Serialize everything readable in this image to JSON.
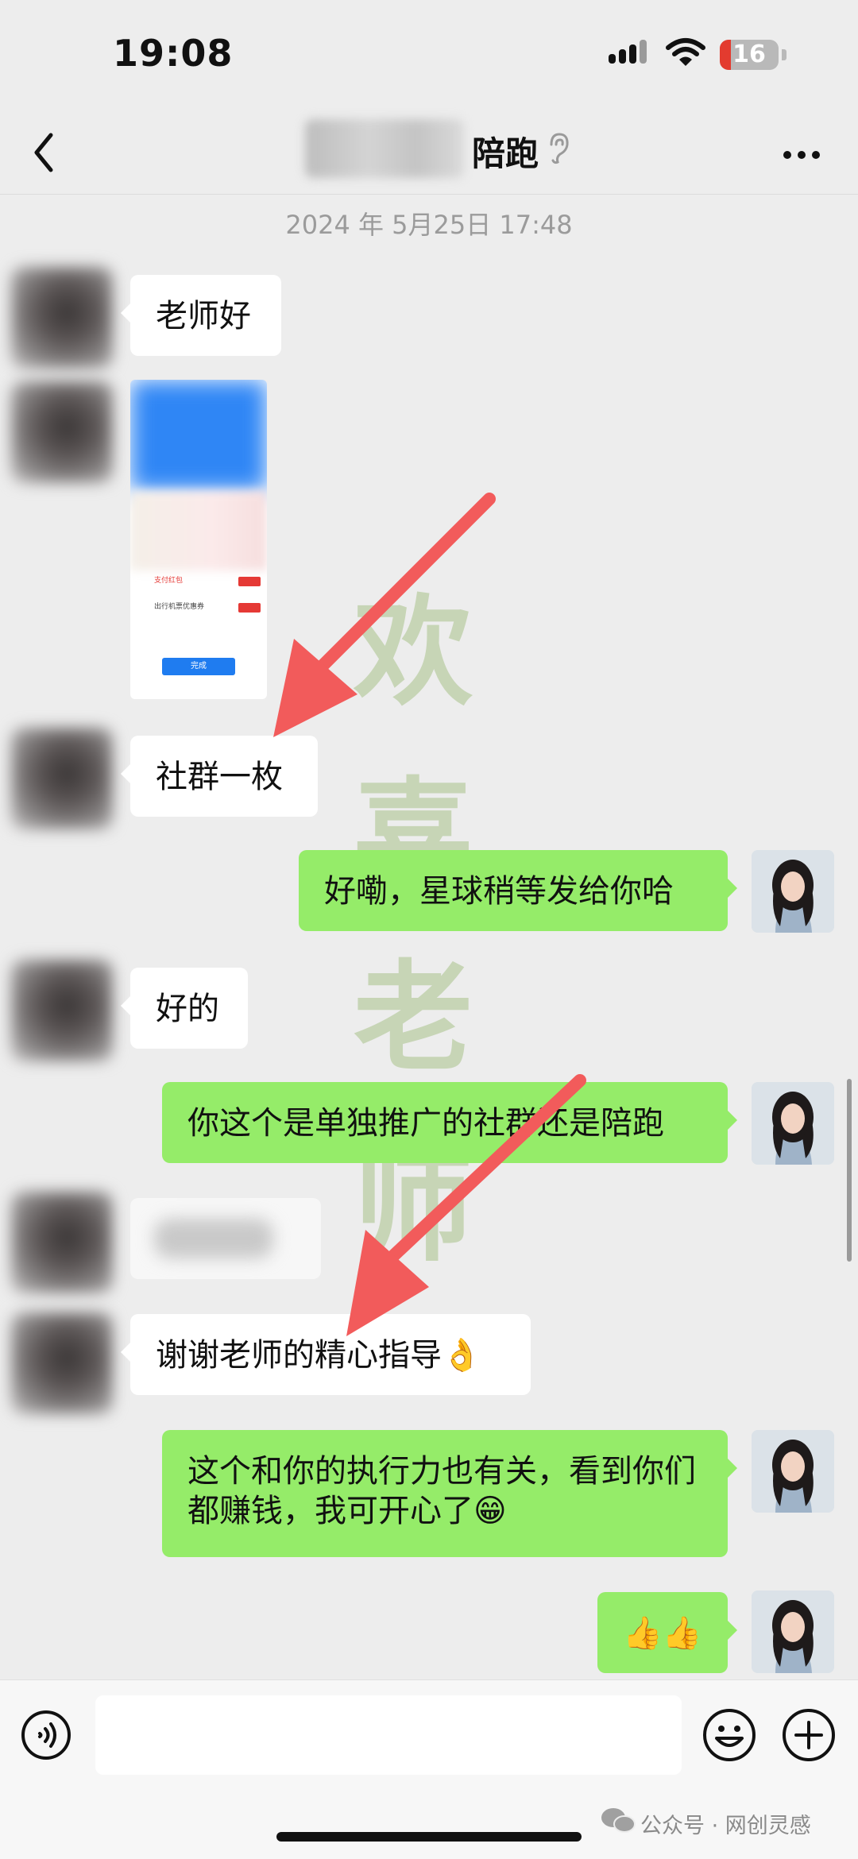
{
  "status_bar": {
    "time": "19:08",
    "battery": "16"
  },
  "nav": {
    "title": "陪跑"
  },
  "timestamp": "2024 年 5月25日 17:48",
  "messages": [
    {
      "side": "left",
      "text": "老师好"
    },
    {
      "side": "left",
      "type": "image",
      "screenshot": {
        "row1": "支付红包",
        "row2": "出行机票优惠券",
        "button": "完成"
      }
    },
    {
      "side": "left",
      "text": "社群一枚"
    },
    {
      "side": "right",
      "text": "好嘞，星球稍等发给你哈"
    },
    {
      "side": "left",
      "text": "好的"
    },
    {
      "side": "right",
      "text": "你这个是单独推广的社群还是陪跑"
    },
    {
      "side": "left",
      "type": "blurred"
    },
    {
      "side": "left",
      "text": "谢谢老师的精心指导👌"
    },
    {
      "side": "right",
      "text": "这个和你的执行力也有关，看到你们都赚钱，我可开心了😁"
    },
    {
      "side": "right",
      "text": "👍👍"
    }
  ],
  "watermark": [
    "欢",
    "喜",
    "老",
    "师"
  ],
  "footer": {
    "brand": "公众号 · 网创灵感"
  },
  "colors": {
    "background": "#ededed",
    "my_bubble": "#95ec69",
    "their_bubble": "#ffffff",
    "arrow": "#f25b5b"
  }
}
